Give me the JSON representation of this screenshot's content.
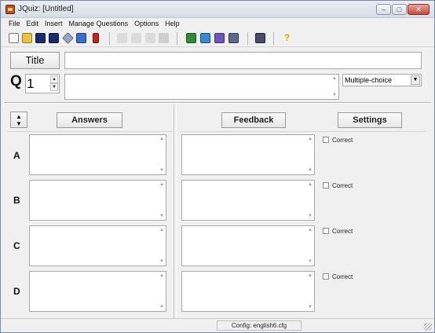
{
  "window": {
    "title": "JQuiz: [Untitled]"
  },
  "menu": [
    "File",
    "Edit",
    "Insert",
    "Manage Questions",
    "Options",
    "Help"
  ],
  "toolbar_icons": [
    "new-file-icon",
    "open-folder-icon",
    "save-icon",
    "save-as-icon",
    "export-icon",
    "web-export-icon",
    "add-question-icon",
    "undo-icon",
    "cut-icon",
    "copy-icon",
    "paste-icon",
    "grid-icon",
    "tile-icon",
    "tree-icon",
    "find-icon",
    "config-icon",
    "help-icon"
  ],
  "title_row": {
    "button": "Title",
    "value": ""
  },
  "question": {
    "label": "Q",
    "number": "1",
    "text": "",
    "type": "Multiple-choice"
  },
  "headers": {
    "answers": "Answers",
    "feedback": "Feedback",
    "settings": "Settings"
  },
  "answers": [
    {
      "label": "A",
      "answer": "",
      "feedback": "",
      "correct_label": "Correct",
      "correct": false
    },
    {
      "label": "B",
      "answer": "",
      "feedback": "",
      "correct_label": "Correct",
      "correct": false
    },
    {
      "label": "C",
      "answer": "",
      "feedback": "",
      "correct_label": "Correct",
      "correct": false
    },
    {
      "label": "D",
      "answer": "",
      "feedback": "",
      "correct_label": "Correct",
      "correct": false
    }
  ],
  "status": {
    "config": "Config: english6.cfg"
  }
}
